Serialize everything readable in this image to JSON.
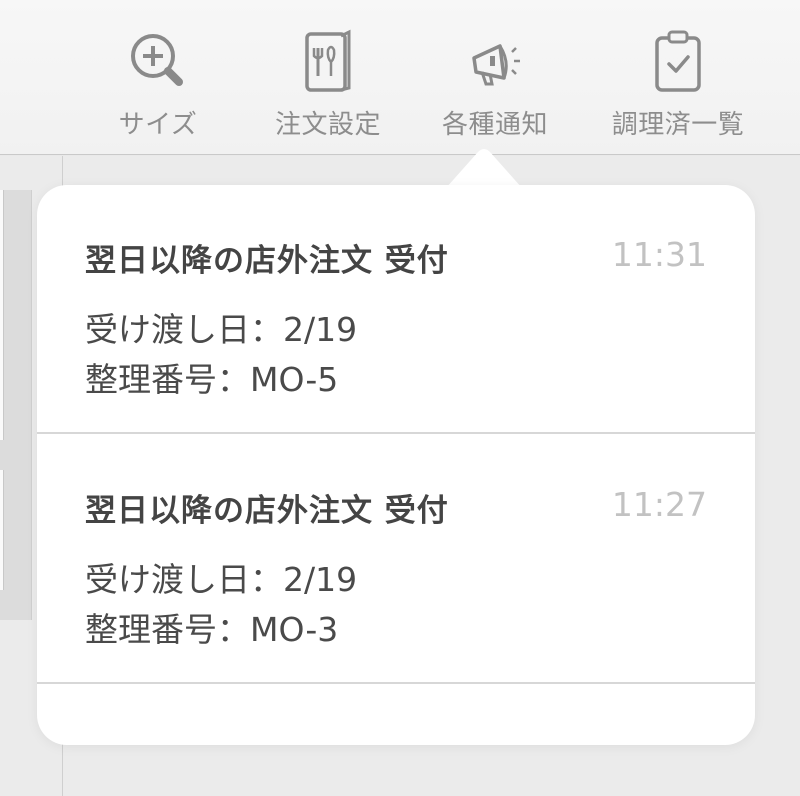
{
  "toolbar": {
    "items": [
      {
        "label": "サイズ",
        "icon": "zoom-in-icon"
      },
      {
        "label": "注文設定",
        "icon": "menu-book-icon"
      },
      {
        "label": "各種通知",
        "icon": "megaphone-icon"
      },
      {
        "label": "調理済一覧",
        "icon": "clipboard-check-icon"
      }
    ]
  },
  "notifications": [
    {
      "title": "翌日以降の店外注文 受付",
      "time": "11:31",
      "line1": "受け渡し日：2/19",
      "line2": "整理番号：MO-5"
    },
    {
      "title": "翌日以降の店外注文 受付",
      "time": "11:27",
      "line1": "受け渡し日：2/19",
      "line2": "整理番号：MO-3"
    }
  ]
}
